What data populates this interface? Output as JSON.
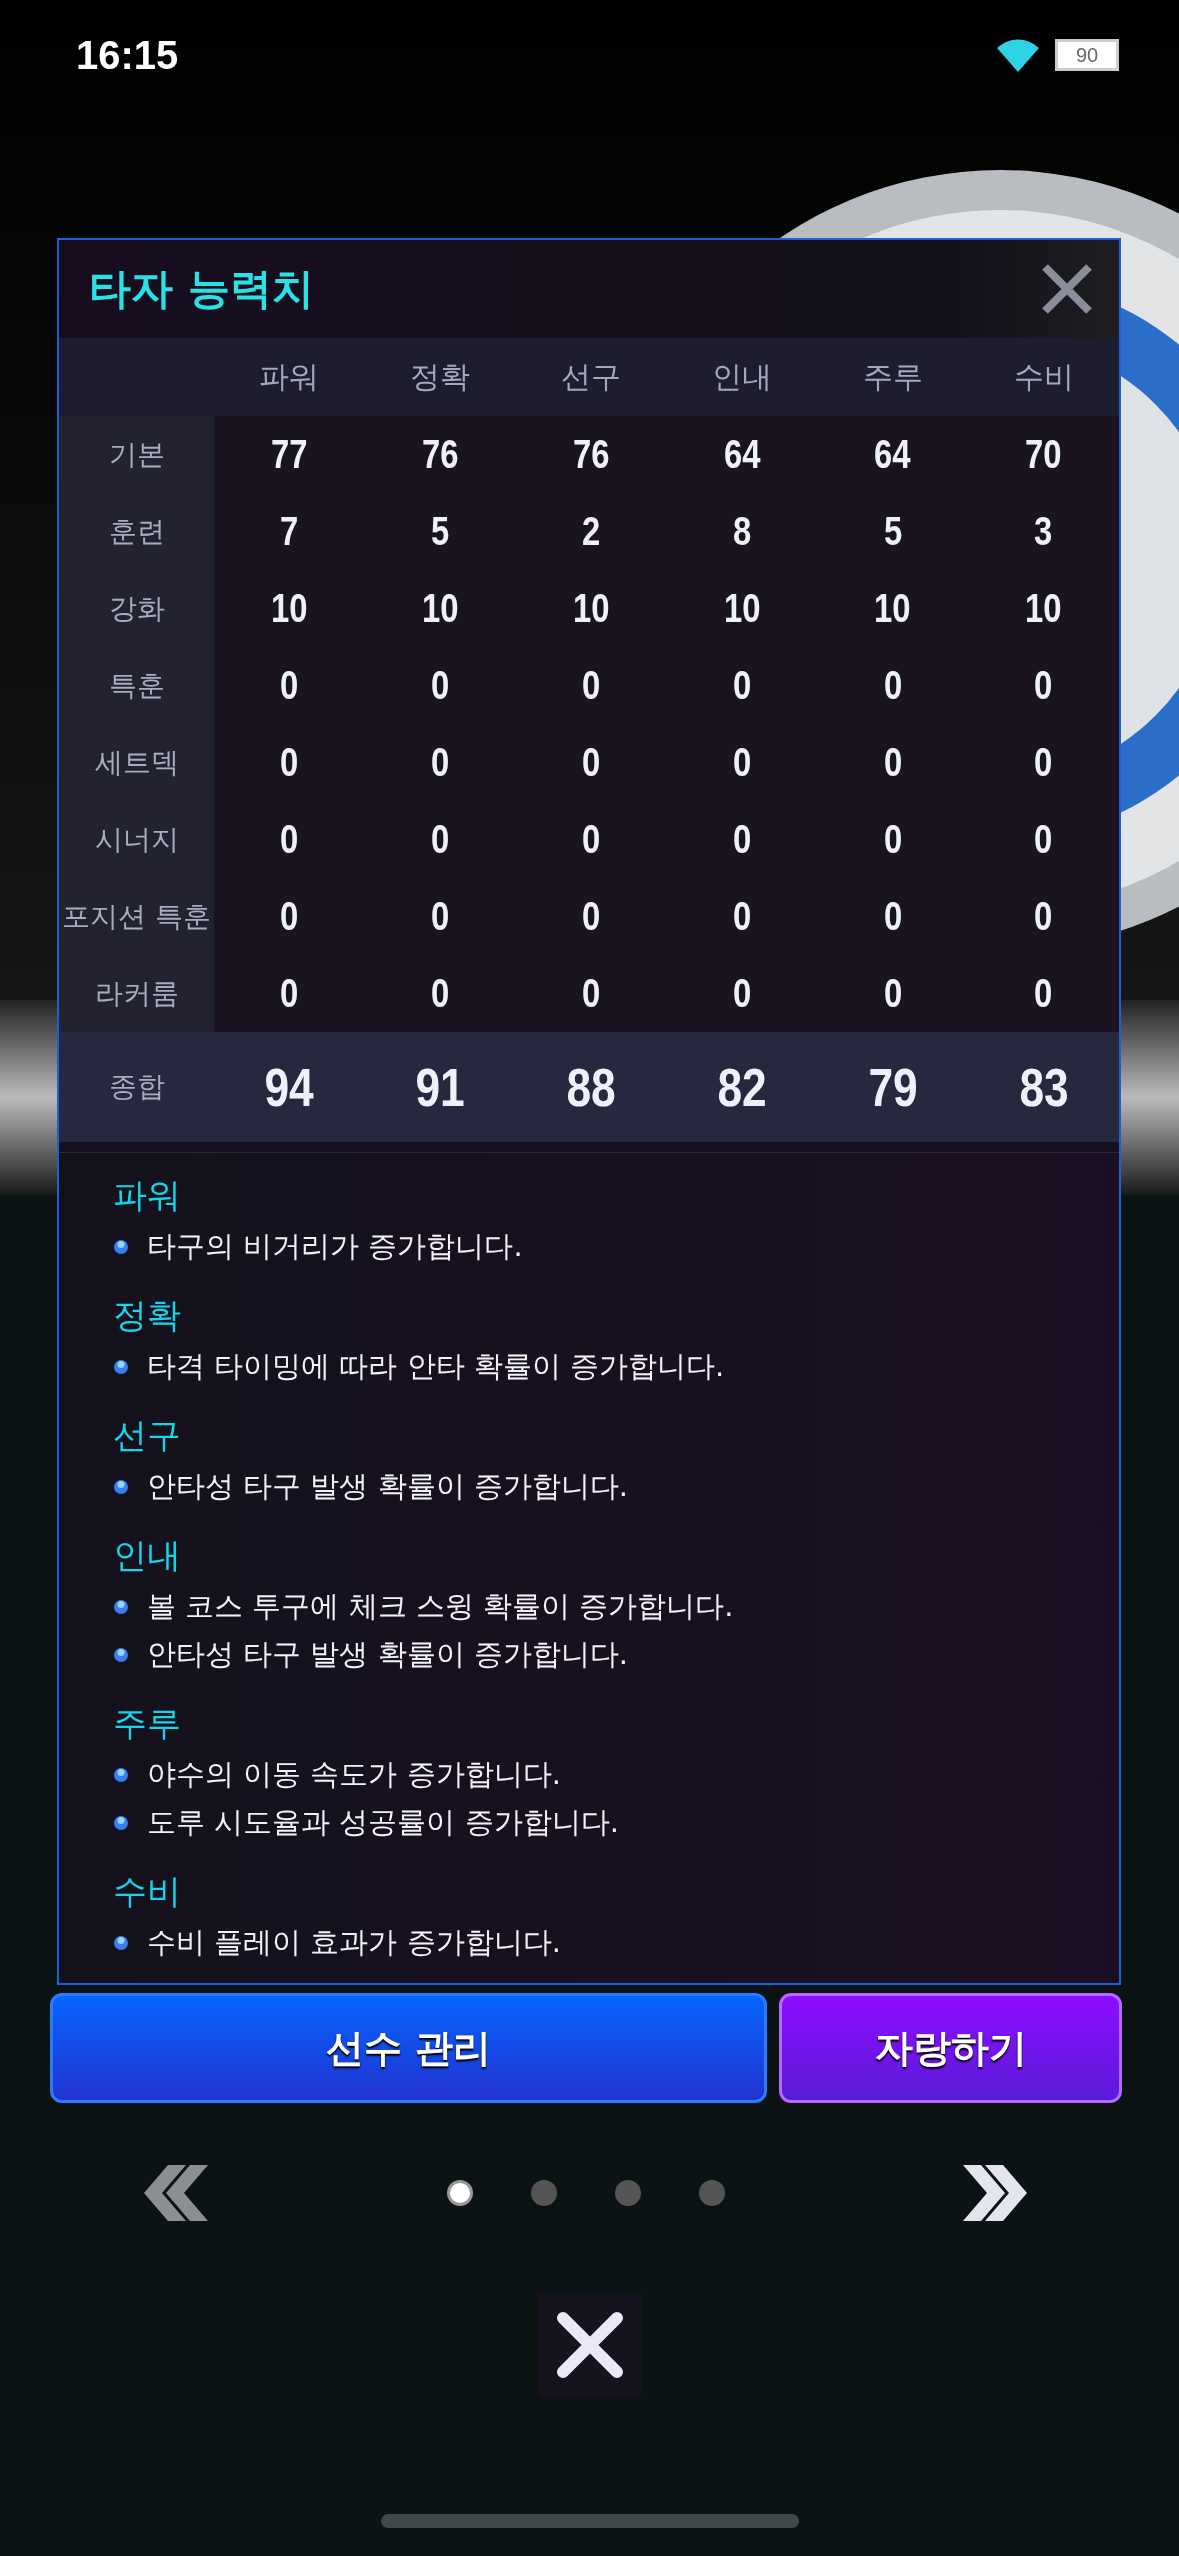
{
  "status_bar": {
    "time": "16:15",
    "battery": "90"
  },
  "panel": {
    "title": "타자 능력치",
    "columns": [
      "파워",
      "정확",
      "선구",
      "인내",
      "주루",
      "수비"
    ],
    "rows": [
      {
        "kind": "regular",
        "label": "기본",
        "values": [
          "77",
          "76",
          "76",
          "64",
          "64",
          "70"
        ]
      },
      {
        "kind": "regular",
        "label": "훈련",
        "values": [
          "7",
          "5",
          "2",
          "8",
          "5",
          "3"
        ]
      },
      {
        "kind": "regular",
        "label": "강화",
        "values": [
          "10",
          "10",
          "10",
          "10",
          "10",
          "10"
        ]
      },
      {
        "kind": "regular",
        "label": "특훈",
        "values": [
          "0",
          "0",
          "0",
          "0",
          "0",
          "0"
        ]
      },
      {
        "kind": "regular",
        "label": "세트덱",
        "values": [
          "0",
          "0",
          "0",
          "0",
          "0",
          "0"
        ]
      },
      {
        "kind": "regular",
        "label": "시너지",
        "values": [
          "0",
          "0",
          "0",
          "0",
          "0",
          "0"
        ]
      },
      {
        "kind": "regular",
        "label": "포지션 특훈",
        "values": [
          "0",
          "0",
          "0",
          "0",
          "0",
          "0"
        ]
      },
      {
        "kind": "regular",
        "label": "라커룸",
        "values": [
          "0",
          "0",
          "0",
          "0",
          "0",
          "0"
        ]
      },
      {
        "kind": "total",
        "label": "종합",
        "values": [
          "94",
          "91",
          "88",
          "82",
          "79",
          "83"
        ]
      }
    ],
    "descriptions": [
      {
        "heading": "파워",
        "lines": [
          "타구의 비거리가 증가합니다."
        ]
      },
      {
        "heading": "정확",
        "lines": [
          "타격 타이밍에 따라 안타 확률이 증가합니다."
        ]
      },
      {
        "heading": "선구",
        "lines": [
          "안타성 타구 발생 확률이 증가합니다."
        ]
      },
      {
        "heading": "인내",
        "lines": [
          "볼 코스 투구에 체크 스윙 확률이 증가합니다.",
          "안타성 타구 발생 확률이 증가합니다."
        ]
      },
      {
        "heading": "주루",
        "lines": [
          "야수의 이동 속도가 증가합니다.",
          "도루 시도율과 성공률이 증가합니다."
        ]
      },
      {
        "heading": "수비",
        "lines": [
          "수비 플레이 효과가 증가합니다."
        ]
      }
    ]
  },
  "buttons": [
    {
      "kind": "primary",
      "label": "선수 관리"
    },
    {
      "kind": "secondary",
      "label": "자랑하기"
    }
  ],
  "pager": [
    {
      "selected": true
    },
    {
      "selected": false
    },
    {
      "selected": false
    },
    {
      "selected": false
    }
  ]
}
